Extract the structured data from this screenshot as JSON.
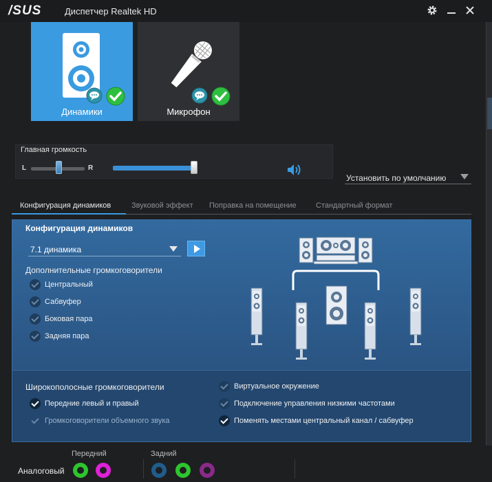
{
  "titlebar": {
    "logo": "/SUS",
    "title": "Диспетчер Realtek HD",
    "settings_icon": "gear-icon",
    "minimize_icon": "minimize-icon",
    "close_icon": "close-icon"
  },
  "devices": [
    {
      "label": "Динамики",
      "icon": "speaker-icon",
      "selected": true
    },
    {
      "label": "Микрофон",
      "icon": "microphone-icon",
      "selected": false
    }
  ],
  "volume": {
    "title": "Главная громкость",
    "balance_left": "L",
    "balance_right": "R",
    "balance_value": 0.5,
    "level_fraction": 0.78
  },
  "default_device": {
    "label": "Установить по умолчанию"
  },
  "tabs": [
    {
      "label": "Конфигурация динамиков",
      "active": true
    },
    {
      "label": "Звуковой эффект",
      "active": false
    },
    {
      "label": "Поправка на помещение",
      "active": false
    },
    {
      "label": "Стандартный формат",
      "active": false
    }
  ],
  "speaker_config": {
    "title": "Конфигурация динамиков",
    "selected": "7.1 динамика",
    "extra_title": "Дополнительные громкоговорители",
    "extra_items": [
      {
        "label": "Центральный",
        "checked": true
      },
      {
        "label": "Сабвуфер",
        "checked": true
      },
      {
        "label": "Боковая пара",
        "checked": true
      },
      {
        "label": "Задняя пара",
        "checked": true
      }
    ]
  },
  "fullrange": {
    "title": "Широкополосные громкоговорители",
    "items": [
      {
        "label": "Передние левый и правый",
        "checked": true
      },
      {
        "label": "Громкоговорители объемного звука",
        "checked": true,
        "disabled": true
      }
    ]
  },
  "options": [
    {
      "label": "Виртуальное окружение",
      "checked": false
    },
    {
      "label": "Подключение управления низкими частотами",
      "checked": false
    },
    {
      "label": "Поменять местами центральный канал / сабвуфер",
      "checked": true
    }
  ],
  "jacks": {
    "analog_label": "Аналоговый",
    "front_label": "Передний",
    "rear_label": "Задний",
    "front": [
      "#2ec52e",
      "#e020d8"
    ],
    "rear": [
      "#1f5d8c",
      "#2ec52e",
      "#8a2a8a"
    ]
  },
  "colors": {
    "accent": "#3a9be0",
    "panel": "#2e5b8c",
    "check_green": "#2fbf40"
  }
}
